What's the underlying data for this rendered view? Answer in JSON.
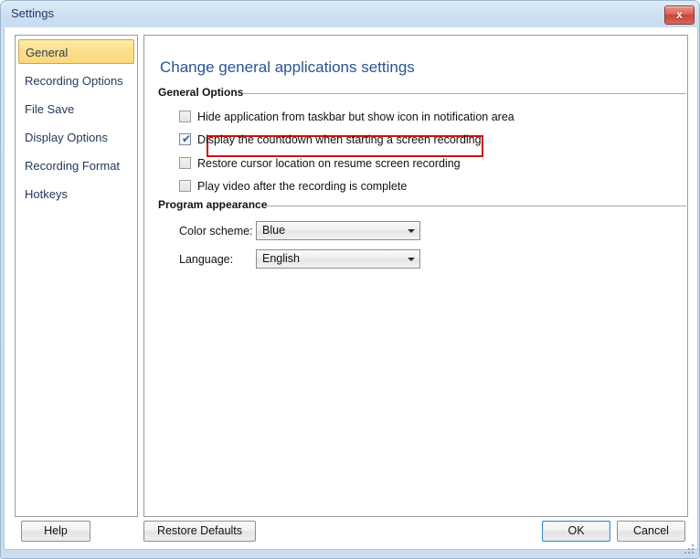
{
  "window": {
    "title": "Settings",
    "close_label": "x"
  },
  "sidebar": {
    "items": [
      {
        "label": "General",
        "selected": true
      },
      {
        "label": "Recording Options",
        "selected": false
      },
      {
        "label": "File Save",
        "selected": false
      },
      {
        "label": "Display Options",
        "selected": false
      },
      {
        "label": "Recording Format",
        "selected": false
      },
      {
        "label": "Hotkeys",
        "selected": false
      }
    ]
  },
  "main": {
    "page_title": "Change general applications settings",
    "groups": {
      "general_options": {
        "header": "General Options",
        "checkboxes": [
          {
            "label": "Hide application from taskbar but show icon in notification area",
            "checked": false,
            "highlighted": false
          },
          {
            "label": "Display the countdown when starting a screen recording",
            "checked": true,
            "highlighted": true
          },
          {
            "label": "Restore cursor location on resume screen recording",
            "checked": false,
            "highlighted": false
          },
          {
            "label": "Play video after the recording is complete",
            "checked": false,
            "highlighted": false
          }
        ]
      },
      "program_appearance": {
        "header": "Program appearance",
        "fields": [
          {
            "label": "Color scheme:",
            "value": "Blue"
          },
          {
            "label": "Language:",
            "value": "English"
          }
        ]
      }
    }
  },
  "footer": {
    "help_label": "Help",
    "restore_defaults_label": "Restore Defaults",
    "ok_label": "OK",
    "cancel_label": "Cancel"
  },
  "colors": {
    "title_text": "#1f3c63",
    "page_title": "#2a5394",
    "selected_nav": "#fcdf8c",
    "highlight_border": "#cc1111",
    "check_mark": "#2c5fa8"
  }
}
